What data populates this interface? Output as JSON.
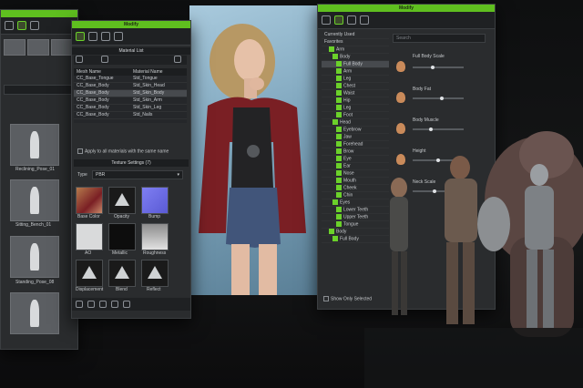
{
  "left_panel": {
    "thumb_labels": [
      "Reclining_Pose_01",
      "Sitting_Bench_01",
      "Standing_Pose_08"
    ]
  },
  "modify_left": {
    "title": "Modify",
    "material_list_header": "Material List",
    "columns": [
      "Mesh Name",
      "Material Name"
    ],
    "rows": [
      {
        "mesh": "CC_Base_Tongue",
        "material": "Std_Tongue",
        "selected": false
      },
      {
        "mesh": "CC_Base_Body",
        "material": "Std_Skin_Head",
        "selected": false
      },
      {
        "mesh": "CC_Base_Body",
        "material": "Std_Skin_Body",
        "selected": true
      },
      {
        "mesh": "CC_Base_Body",
        "material": "Std_Skin_Arm",
        "selected": false
      },
      {
        "mesh": "CC_Base_Body",
        "material": "Std_Skin_Leg",
        "selected": false
      },
      {
        "mesh": "CC_Base_Body",
        "material": "Std_Nails",
        "selected": false
      }
    ],
    "apply_all_text": "Apply to all materials with the same name",
    "texture_settings_header": "Texture Settings (7)",
    "type_label": "Type",
    "type_value": "PBR",
    "textures": [
      "Base Color",
      "Opacity",
      "Bump",
      "AO",
      "Metallic",
      "Roughness",
      "Displacement",
      "Blend",
      "Reflect"
    ]
  },
  "modify_right": {
    "title": "Modify",
    "search_placeholder": "Search",
    "tree": [
      "Currently Used",
      "Favorites",
      "Arm",
      "Body",
      "Full Body",
      "Arm",
      "Leg",
      "Chest",
      "Waist",
      "Hip",
      "Leg",
      "Foot",
      "Head",
      "Eyebrow",
      "Jaw",
      "Forehead",
      "Brow",
      "Eye",
      "Ear",
      "Nose",
      "Mouth",
      "Cheek",
      "Chin",
      "Eyes",
      "Lower Teeth",
      "Upper Teeth",
      "Tongue",
      "Body",
      "Full Body"
    ],
    "slider_labels": [
      "Full Body Scale",
      "Body Fat",
      "Body Muscle",
      "Height",
      "Neck Scale"
    ],
    "show_selected_label": "Show Only Selected"
  },
  "colors": {
    "accent_green": "#5fbf1f",
    "panel_bg": "#2a2c2e",
    "viewport_blue": "#8fb3c9"
  },
  "icons": [
    "pose-icon",
    "figure-icon",
    "grid-icon",
    "morph-icon",
    "material-icon",
    "warning-icon"
  ]
}
